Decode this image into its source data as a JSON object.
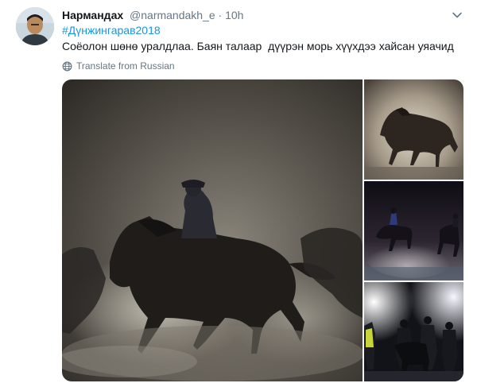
{
  "user": {
    "display_name": "Нармандах",
    "handle": "@narmandakh_e",
    "separator": "·",
    "time": "10h",
    "avatar_icon": "user-avatar"
  },
  "tweet": {
    "hashtag": "#Дүнжингарав2018",
    "text": "Соёолон шөнө уралдлаа. Баян талаар  дүүрэн морь хүүхдээ хайсан уяачид",
    "translate_label": "Translate from Russian"
  },
  "icons": {
    "caret": "chevron-down-icon",
    "translate": "globe-icon"
  },
  "colors": {
    "link": "#1b95e0",
    "text": "#14171a",
    "secondary": "#657786"
  }
}
